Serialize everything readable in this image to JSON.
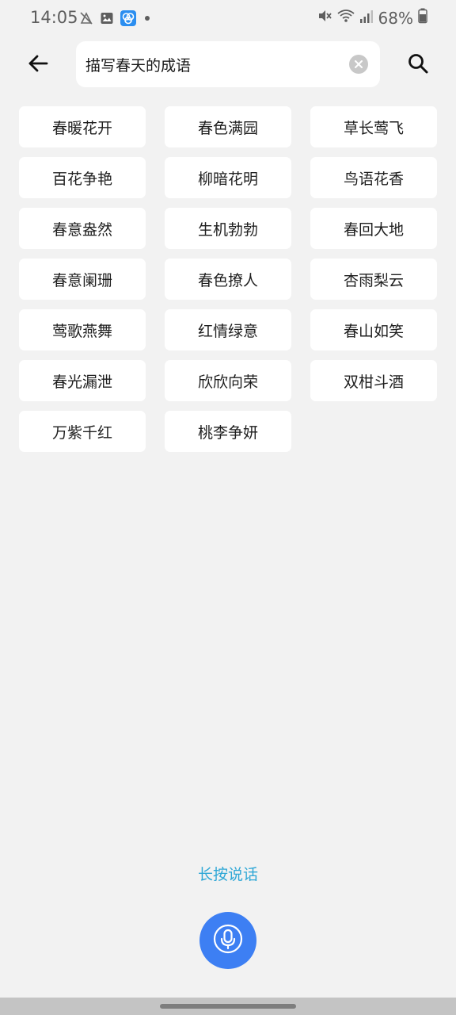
{
  "status_bar": {
    "time": "14:05",
    "battery": "68%",
    "left_icons": [
      "notification-muted-icon",
      "gallery-icon",
      "app-icon",
      "dot-icon"
    ],
    "right_icons": [
      "mute-icon",
      "wifi-icon",
      "signal-icon",
      "battery-icon"
    ]
  },
  "search": {
    "query": "描写春天的成语"
  },
  "results": [
    {
      "label": "春暖花开"
    },
    {
      "label": "春色满园"
    },
    {
      "label": "草长莺飞"
    },
    {
      "label": "百花争艳"
    },
    {
      "label": "柳暗花明"
    },
    {
      "label": "鸟语花香"
    },
    {
      "label": "春意盎然"
    },
    {
      "label": "生机勃勃"
    },
    {
      "label": "春回大地"
    },
    {
      "label": "春意阑珊"
    },
    {
      "label": "春色撩人"
    },
    {
      "label": "杏雨梨云"
    },
    {
      "label": "莺歌燕舞"
    },
    {
      "label": "红情绿意"
    },
    {
      "label": "春山如笑"
    },
    {
      "label": "春光漏泄"
    },
    {
      "label": "欣欣向荣"
    },
    {
      "label": "双柑斗酒"
    },
    {
      "label": "万紫千红"
    },
    {
      "label": "桃李争妍"
    }
  ],
  "voice": {
    "hint": "长按说话"
  },
  "colors": {
    "accent": "#3d7ff3",
    "hint": "#2ea7d6",
    "background": "#f2f2f2"
  }
}
